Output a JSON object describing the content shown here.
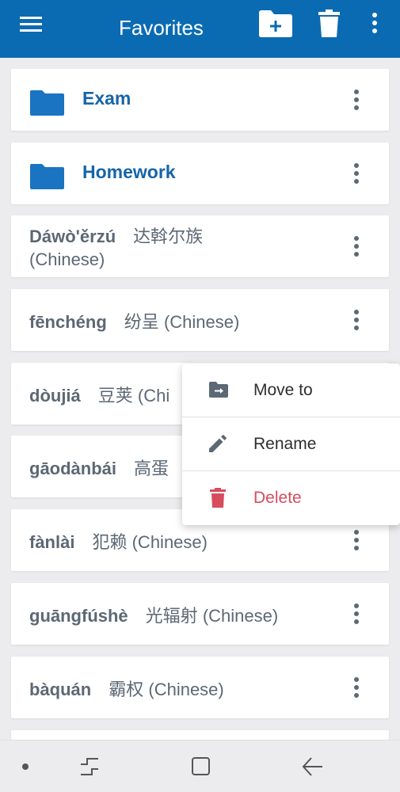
{
  "appbar": {
    "title": "Favorites",
    "icons": [
      "menu-icon",
      "new-folder-icon",
      "delete-icon",
      "more-vert-icon"
    ]
  },
  "folders": [
    {
      "name": "Exam",
      "icon": "folder-icon"
    },
    {
      "name": "Homework",
      "icon": "folder-icon"
    }
  ],
  "words": [
    {
      "pinyin": "Dáwò'ěrzú",
      "hanzi": "达斡尔族",
      "lang": "(Chinese)"
    },
    {
      "pinyin": "fēnchéng",
      "hanzi": "纷呈",
      "lang": "(Chinese)"
    },
    {
      "pinyin": "dòujiá",
      "hanzi": "豆荚",
      "lang": "(Chi"
    },
    {
      "pinyin": "gāodànbái",
      "hanzi": "高蛋",
      "lang": ""
    },
    {
      "pinyin": "fànlài",
      "hanzi": "犯赖",
      "lang": "(Chinese)"
    },
    {
      "pinyin": "guāngfúshè",
      "hanzi": "光辐射",
      "lang": "(Chinese)"
    },
    {
      "pinyin": "bàquán",
      "hanzi": "霸权",
      "lang": "(Chinese)"
    }
  ],
  "context_menu": {
    "items": [
      {
        "label": "Move to",
        "icon": "move-to-folder-icon"
      },
      {
        "label": "Rename",
        "icon": "pencil-icon"
      },
      {
        "label": "Delete",
        "icon": "trash-icon"
      }
    ]
  },
  "navbar": {
    "icons": [
      "dot-icon",
      "recent-apps-icon",
      "home-icon",
      "back-icon"
    ]
  },
  "colors": {
    "primary": "#0a6bb2",
    "folder": "#1a74c1",
    "text": "#5c6874",
    "delete": "#d64d5e",
    "background": "#ececee"
  }
}
